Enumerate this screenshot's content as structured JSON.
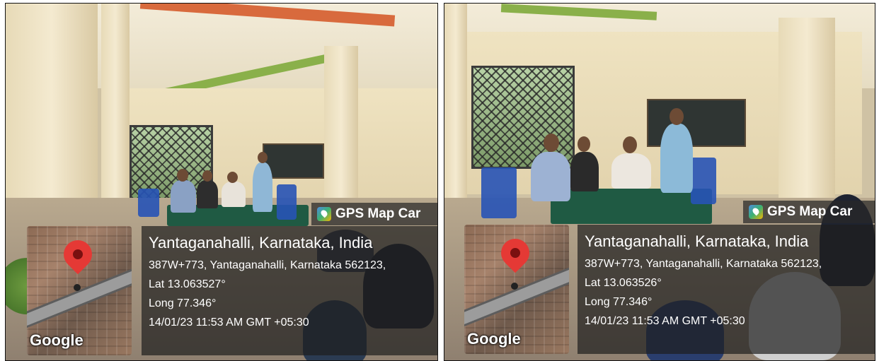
{
  "panels": [
    {
      "overlay": {
        "app_label": "GPS Map Car",
        "map_logo": "Google",
        "place": "Yantaganahalli, Karnataka, India",
        "address": "387W+773, Yantaganahalli, Karnataka 562123,",
        "lat": "Lat 13.063527°",
        "long": "Long 77.346°",
        "datetime": "14/01/23 11:53 AM GMT +05:30"
      }
    },
    {
      "overlay": {
        "app_label": "GPS Map Car",
        "map_logo": "Google",
        "place": "Yantaganahalli, Karnataka, India",
        "address": "387W+773, Yantaganahalli, Karnataka 562123,",
        "lat": "Lat 13.063526°",
        "long": "Long 77.346°",
        "datetime": "14/01/23 11:53 AM GMT +05:30"
      }
    }
  ]
}
